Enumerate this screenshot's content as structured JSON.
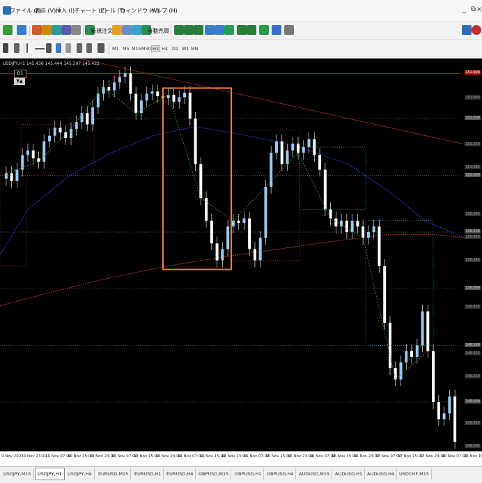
{
  "menubar": {
    "items": [
      "ファイル (F)",
      "表示 (V)",
      "挿入 (I)",
      "チャート (C)",
      "ツール (T)",
      "ウィンドウ (W)",
      "ヘルプ (H)"
    ],
    "window_controls": [
      "_",
      "⧉",
      "×"
    ]
  },
  "toolbar1": {
    "new_order_label": "新規注文",
    "auto_trading_label": "自動売買"
  },
  "toolbar2": {
    "timeframes": [
      "M1",
      "M5",
      "M15",
      "M30",
      "H1",
      "H4",
      "D1",
      "W1",
      "MN"
    ],
    "active_timeframe": "H1",
    "drawing_tools": [
      "cursor",
      "crosshair",
      "vertical-line",
      "horizontal-line",
      "trendline",
      "channel",
      "fibonacci",
      "text",
      "label",
      "arrow"
    ]
  },
  "chart": {
    "title": "USDJPY,H1  145.436 145.444 145.307 145.422",
    "timeframe_box": "D1",
    "arrows": "▼▲",
    "price_labels": [
      "151.900",
      "151.680",
      "151.500",
      "151.270",
      "151.065",
      "151.000",
      "150.655",
      "150.500",
      "150.450",
      "150.245",
      "150.000",
      "149.835",
      "149.500",
      "149.425",
      "149.220",
      "149.000",
      "148.810",
      "148.605"
    ],
    "highlight_price": "151.900"
  },
  "chart_data": {
    "type": "candlestick",
    "symbol": "USDJPY",
    "timeframe": "H1",
    "x_labels": [
      "9 Nov 2023",
      "9 Nov 23:00",
      "10 Nov 07:00",
      "10 Nov 15:00",
      "10 Nov 23:00",
      "13 Nov 07:00",
      "13 Nov 15:00",
      "13 Nov 23:00",
      "14 Nov 07:00",
      "14 Nov 15:00",
      "14 Nov 23:00",
      "15 Nov 07:00",
      "15 Nov 15:00",
      "15 Nov 23:00",
      "16 Nov 07:00",
      "16 Nov 15:00",
      "16 Nov 23:00",
      "17 Nov 07:00",
      "17 Nov 15:00",
      "17 Nov 23:00",
      "20 Nov 07:00",
      "20 Nov 15:00"
    ],
    "y_ticks": [
      151.9,
      151.68,
      151.5,
      151.27,
      151.065,
      151.0,
      150.655,
      150.5,
      150.45,
      150.245,
      150.0,
      149.835,
      149.5,
      149.425,
      149.22,
      149.0,
      148.81,
      148.605
    ],
    "ylim": [
      148.6,
      152.0
    ],
    "close": [
      151.02,
      150.95,
      151.05,
      151.18,
      151.22,
      151.15,
      151.12,
      151.3,
      151.35,
      151.42,
      151.38,
      151.33,
      151.41,
      151.47,
      151.55,
      151.45,
      151.6,
      151.72,
      151.78,
      151.75,
      151.82,
      151.87,
      151.9,
      151.72,
      151.55,
      151.66,
      151.72,
      151.74,
      151.7,
      151.68,
      151.71,
      151.65,
      151.69,
      151.73,
      151.5,
      151.1,
      150.8,
      150.6,
      150.4,
      150.25,
      150.35,
      150.55,
      150.6,
      150.58,
      150.62,
      150.35,
      150.25,
      150.45,
      150.9,
      151.2,
      151.3,
      151.1,
      151.22,
      151.28,
      151.2,
      151.25,
      151.32,
      151.18,
      151.05,
      150.7,
      150.62,
      150.55,
      150.6,
      150.5,
      150.6,
      150.55,
      150.45,
      150.5,
      150.55,
      150.2,
      149.7,
      149.3,
      149.2,
      149.35,
      149.45,
      149.4,
      149.5,
      149.8,
      149.45,
      149.0,
      148.85,
      148.9,
      149.05,
      148.65
    ],
    "moving_average_blue": [
      [
        0,
        150.3
      ],
      [
        40,
        150.7
      ],
      [
        100,
        151.0
      ],
      [
        160,
        151.2
      ],
      [
        220,
        151.35
      ],
      [
        280,
        151.43
      ],
      [
        320,
        151.39
      ],
      [
        380,
        151.32
      ],
      [
        430,
        151.25
      ],
      [
        500,
        151.1
      ],
      [
        560,
        150.85
      ],
      [
        610,
        150.6
      ],
      [
        670,
        150.44
      ]
    ],
    "moving_average_red": [
      [
        0,
        149.85
      ],
      [
        80,
        149.98
      ],
      [
        160,
        150.1
      ],
      [
        240,
        150.2
      ],
      [
        320,
        150.28
      ],
      [
        400,
        150.35
      ],
      [
        480,
        150.42
      ],
      [
        560,
        150.48
      ],
      [
        620,
        150.48
      ],
      [
        670,
        150.45
      ]
    ],
    "trendline": [
      [
        100,
        152.05
      ],
      [
        670,
        151.27
      ]
    ],
    "highlight_box": [
      [
        234,
        151.77
      ],
      [
        332,
        150.17
      ]
    ],
    "grid": false,
    "legend": "none"
  },
  "tabs": [
    "USDJPY,M15",
    "USDJPY,H1",
    "USDJPY,H4",
    "EURUSD,M15",
    "EURUSD,H1",
    "EURUSD,H4",
    "GBPUSD,M15",
    "GBPUSD,H1",
    "GBPUSD,H4",
    "AUDUSD,M15",
    "AUDUSD,H1",
    "AUDUSD,H4",
    "USDCHF,M15"
  ],
  "active_tab": "USDJPY,H1",
  "colors": {
    "bull": "#9cc9ee",
    "bear": "#ffffff",
    "ma_blue": "#2338c9",
    "ma_red": "#b43a2c",
    "trendline": "#9a2b2b",
    "highlight_box": "#f07f2a",
    "current_price": "#ff2020",
    "zone": "#b0b0b0"
  }
}
